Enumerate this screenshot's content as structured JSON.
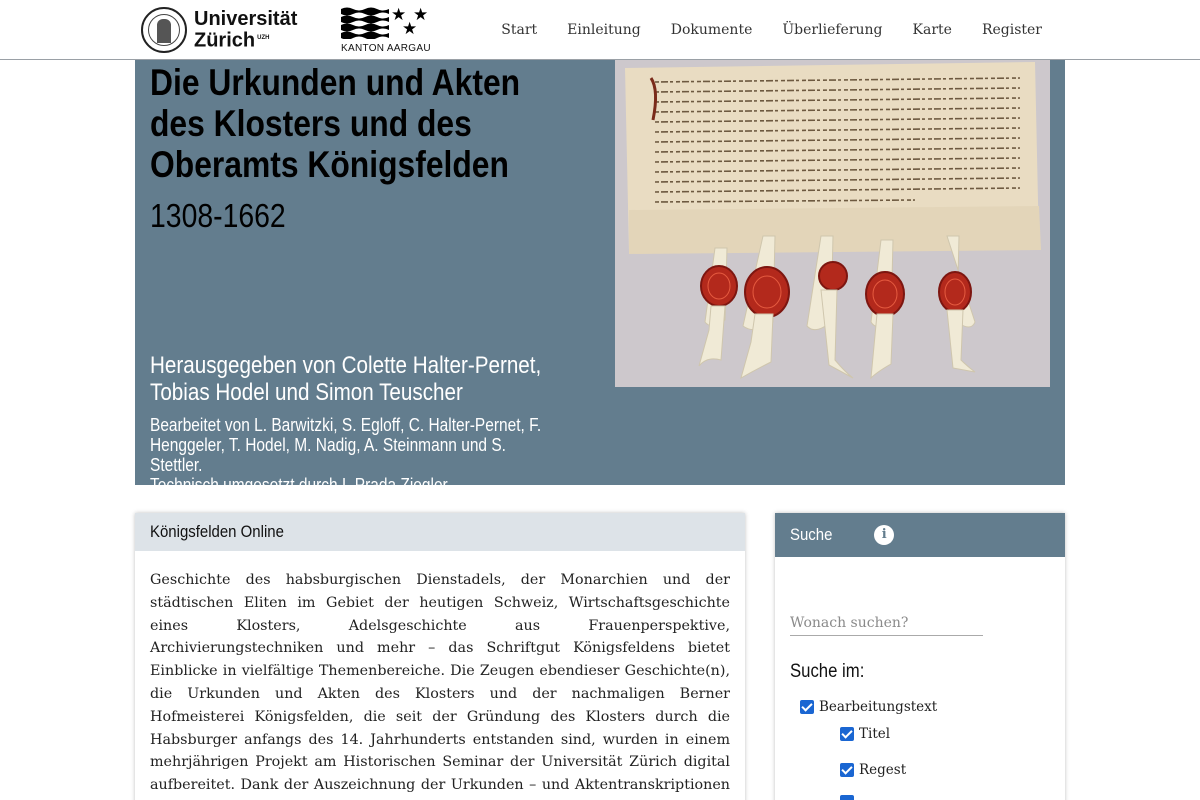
{
  "header": {
    "uzh_logo": {
      "line1": "Universität",
      "line2": "Zürich",
      "suffix": "UZH"
    },
    "aargau_logo": {
      "label": "KANTON AARGAU"
    },
    "nav": [
      {
        "label": "Start"
      },
      {
        "label": "Einleitung"
      },
      {
        "label": "Dokumente"
      },
      {
        "label": "Überlieferung"
      },
      {
        "label": "Karte"
      },
      {
        "label": "Register"
      }
    ]
  },
  "hero": {
    "title": "Die Urkunden und Akten des Klosters und des Oberamts Königsfelden",
    "years": "1308-1662",
    "editors": "Herausgegeben von Colette Halter-Pernet, Tobias Hodel und Simon Teuscher",
    "credits_line1": "Bearbeitet von L. Barwitzki, S. Egloff, C. Halter-Pernet, F. Henggeler, T. Hodel, M. Nadig, A. Steinmann und S. Stettler.",
    "credits_line2": "Technisch umgesetzt durch I. Prada Ziegler",
    "image": "medieval charter with five red wax seals"
  },
  "intro_card": {
    "title": "Königsfelden Online",
    "text": "Geschichte des habsburgischen Dienstadels, der Monarchien und der städtischen Eliten im Gebiet der heutigen Schweiz, Wirtschaftsgeschichte eines Klosters, Adelsgeschichte aus Frauenperspektive, Archivierungstechniken und mehr – das Schriftgut Königsfeldens bietet Einblicke in vielfältige Themenbereiche. Die Zeugen ebendieser Geschichte(n), die Urkunden und Akten des Klosters und der nachmaligen Berner Hofmeisterei Königsfelden, die seit der Gründung des Klosters durch die Habsburger anfangs des 14. Jahrhunderts entstanden sind, wurden in einem mehrjährigen Projekt am Historischen Seminar der Universität Zürich digital aufbereitet. Dank der Auszeichnung der Urkunden – und Aktentranskriptionen mit Registerdaten wie"
  },
  "search_card": {
    "title": "Suche",
    "info_icon": "info-icon",
    "placeholder": "Wonach suchen?",
    "search_in_label": "Suche im:",
    "options": [
      {
        "label": "Bearbeitungstext",
        "checked": true
      },
      {
        "label": "Titel",
        "checked": true
      },
      {
        "label": "Regest",
        "checked": true
      }
    ]
  },
  "colors": {
    "hero_bg": "#637d8e",
    "card_head_light": "#dde3e8",
    "checkbox": "#1a66d2"
  }
}
